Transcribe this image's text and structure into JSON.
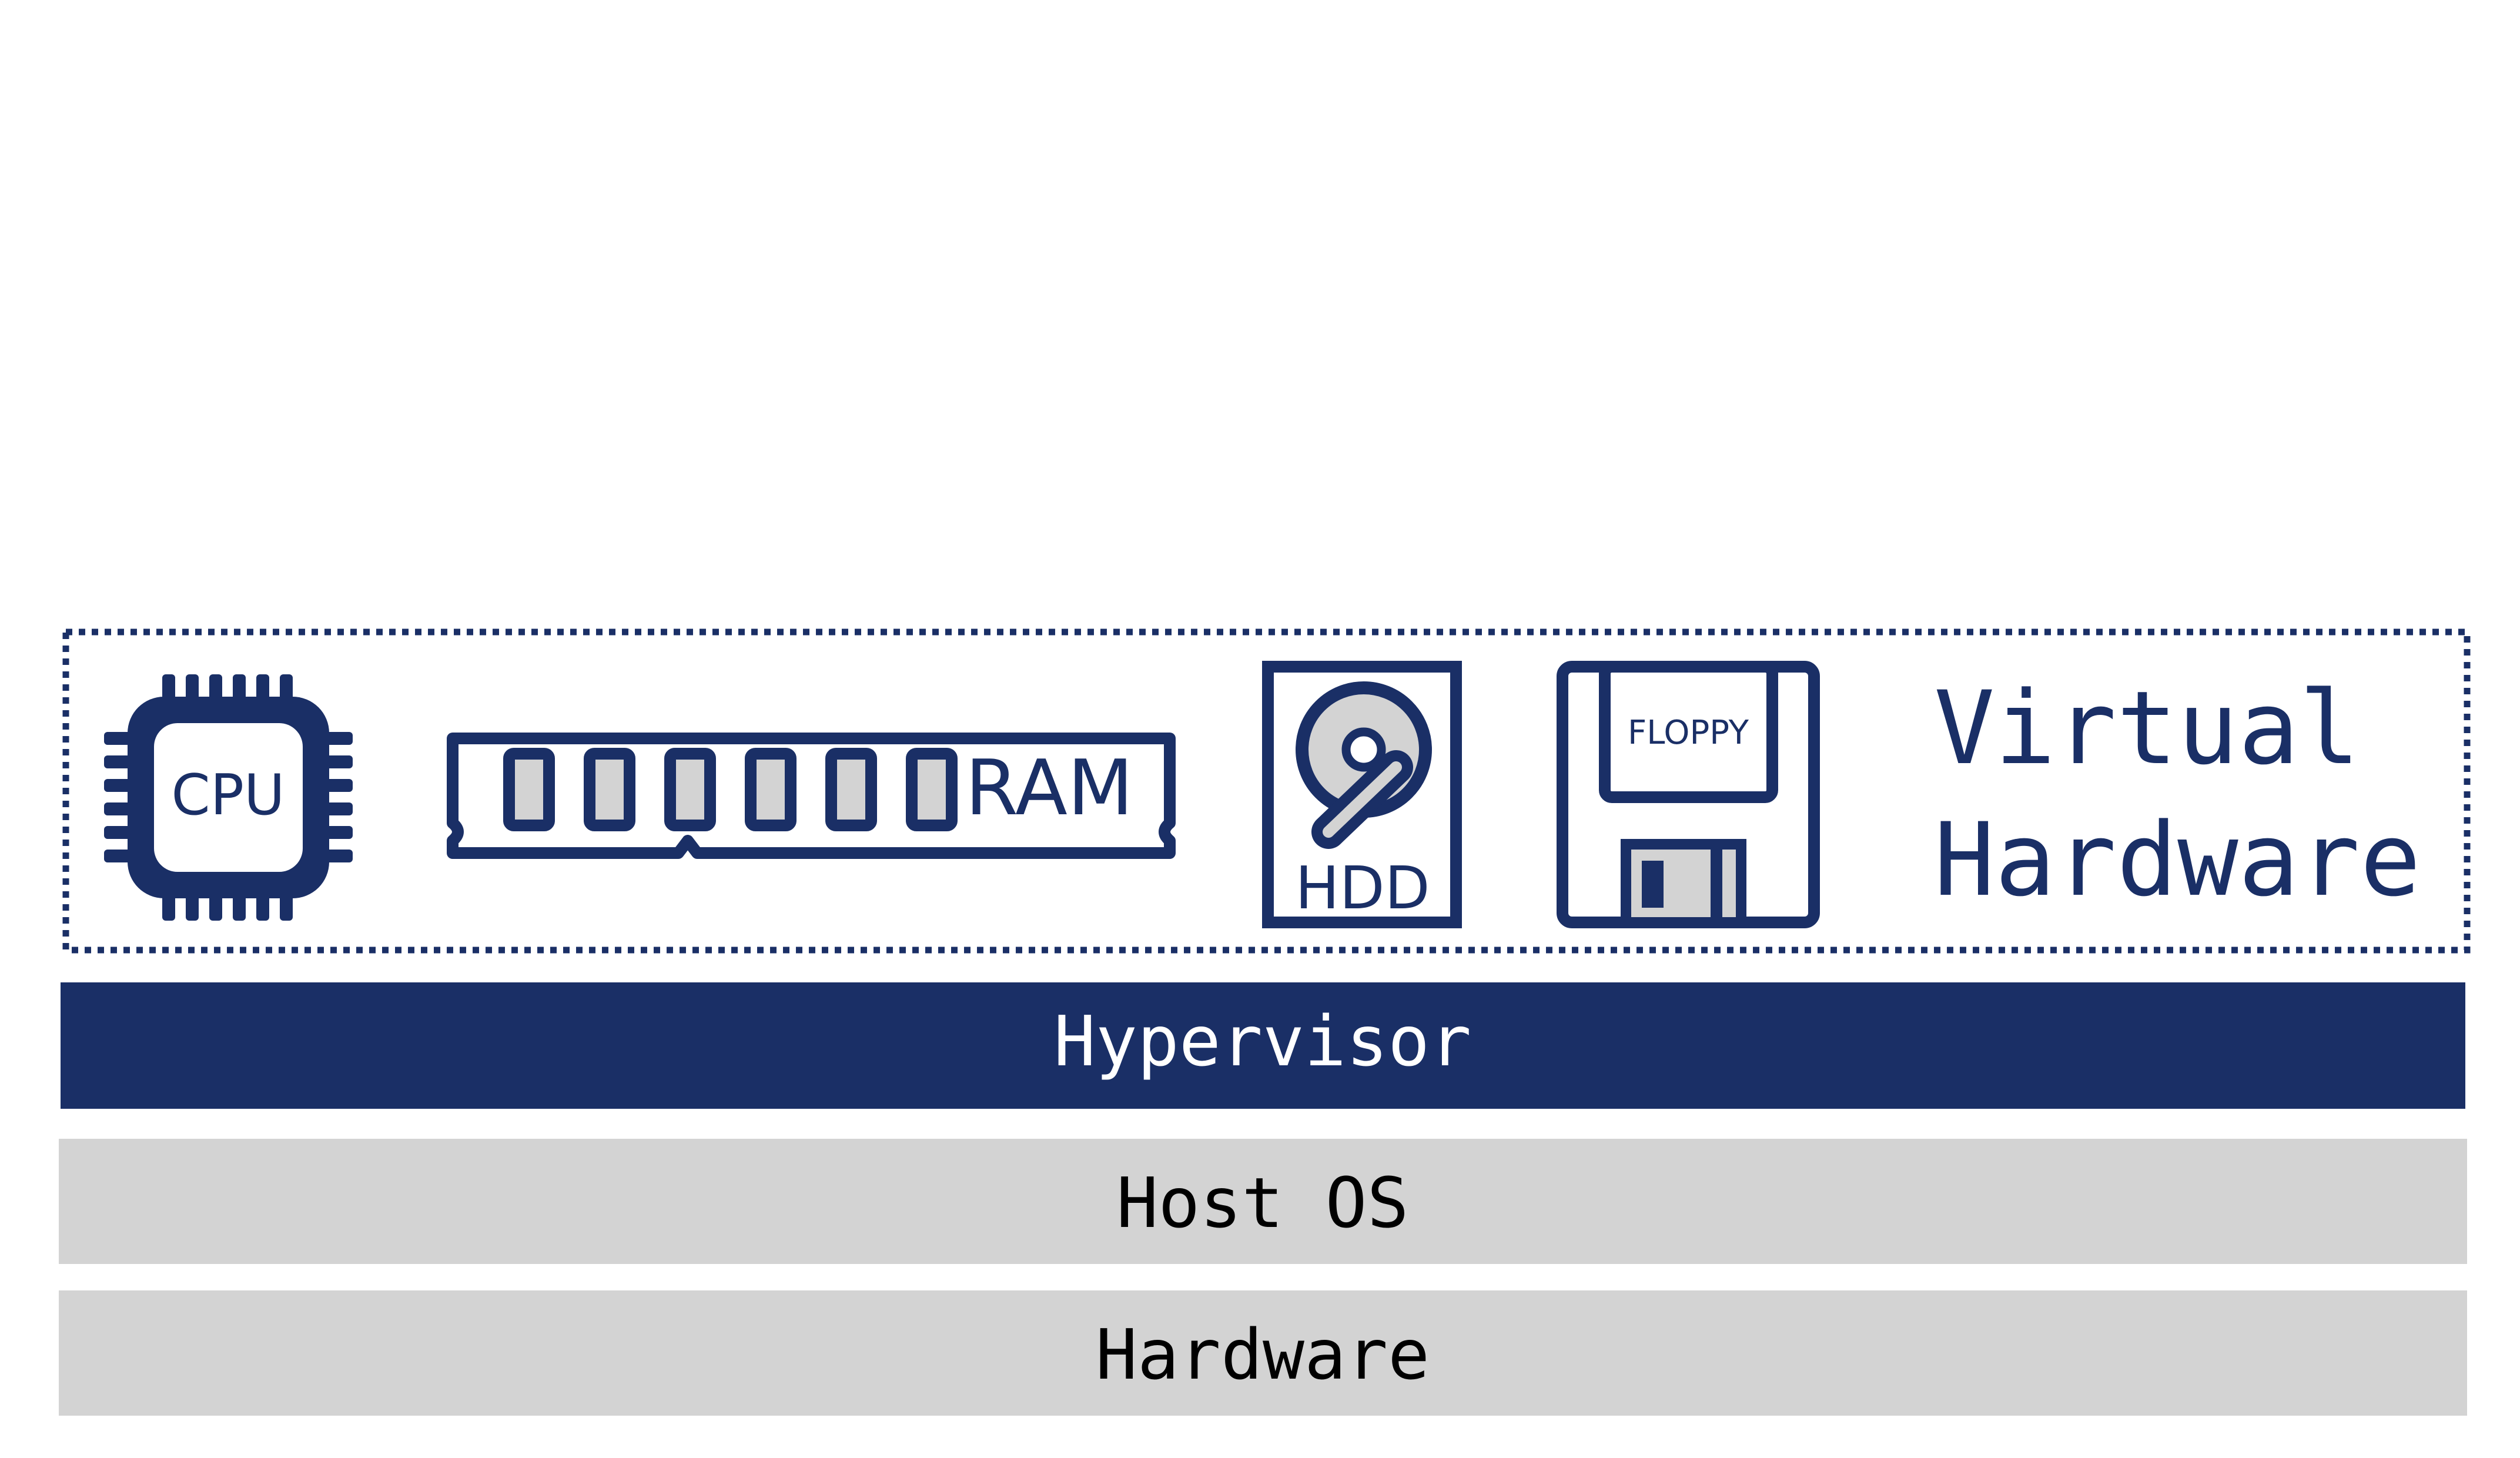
{
  "colors": {
    "navy": "#1a2f66",
    "grey_fill": "#d3d3d3",
    "white": "#ffffff",
    "text_dark": "#000000"
  },
  "virtual_hardware": {
    "label_line1": "Virtual",
    "label_line2": "Hardware",
    "components": {
      "cpu": {
        "label": "CPU",
        "icon": "cpu-chip-icon"
      },
      "ram": {
        "label": "RAM",
        "icon": "ram-module-icon"
      },
      "hdd": {
        "label": "HDD",
        "icon": "hard-disk-icon"
      },
      "floppy": {
        "label": "FLOPPY",
        "icon": "floppy-disk-icon"
      }
    }
  },
  "layers": {
    "hypervisor": "Hypervisor",
    "host_os": "Host OS",
    "hardware": "Hardware"
  }
}
